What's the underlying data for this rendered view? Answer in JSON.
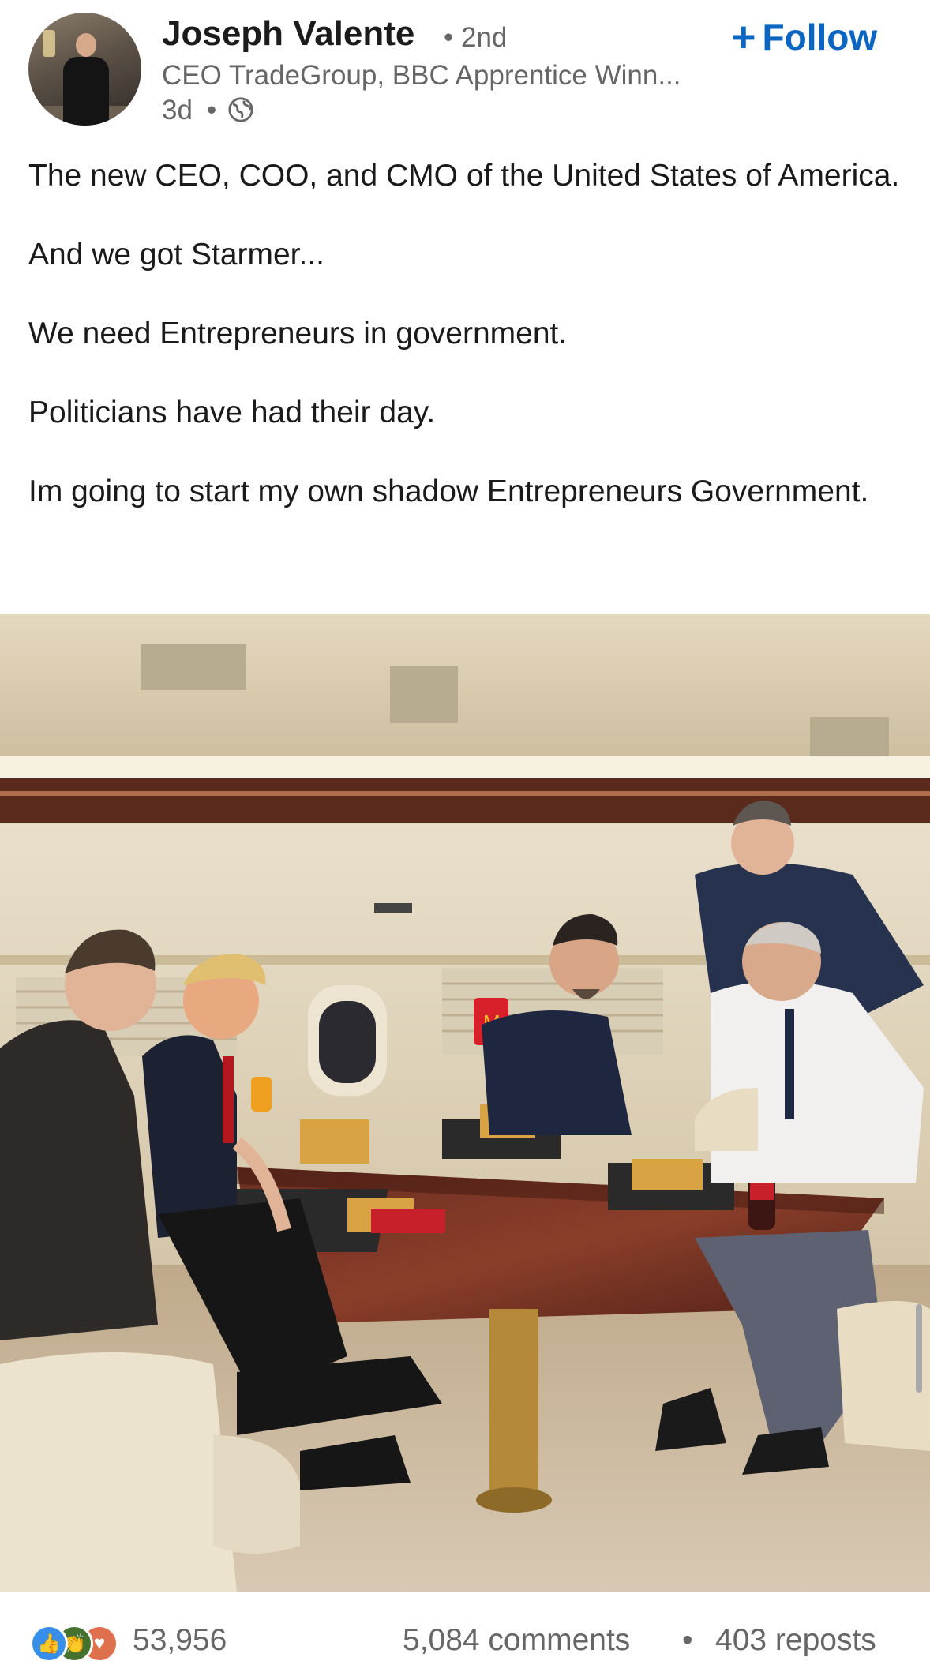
{
  "author": {
    "name": "Joseph Valente",
    "degree": "• 2nd",
    "headline": "CEO TradeGroup, BBC Apprentice Winn...",
    "time": "3d",
    "visibility_icon": "globe-icon"
  },
  "follow": {
    "label": "Follow",
    "icon": "plus-icon"
  },
  "post": {
    "paragraphs": [
      "The new CEO, COO, and CMO of the United States of America.",
      "And we got Starmer...",
      "We need Entrepreneurs in government.",
      "Politicians have had their day.",
      "Im going to start my own shadow Entrepreneurs Government."
    ]
  },
  "photo": {
    "scene": "group-dining-on-private-jet",
    "icon": "mcdonalds-logo"
  },
  "social": {
    "reaction_icons": [
      "like-icon",
      "celebrate-icon",
      "love-icon"
    ],
    "reactions_count": "53,956",
    "comments": "5,084 comments",
    "separator": "•",
    "reposts": "403 reposts"
  },
  "colors": {
    "accent": "#0a66c2",
    "secondary_text": "#666666",
    "like": "#378fe9",
    "celebrate": "#44712e",
    "love": "#df704d"
  }
}
